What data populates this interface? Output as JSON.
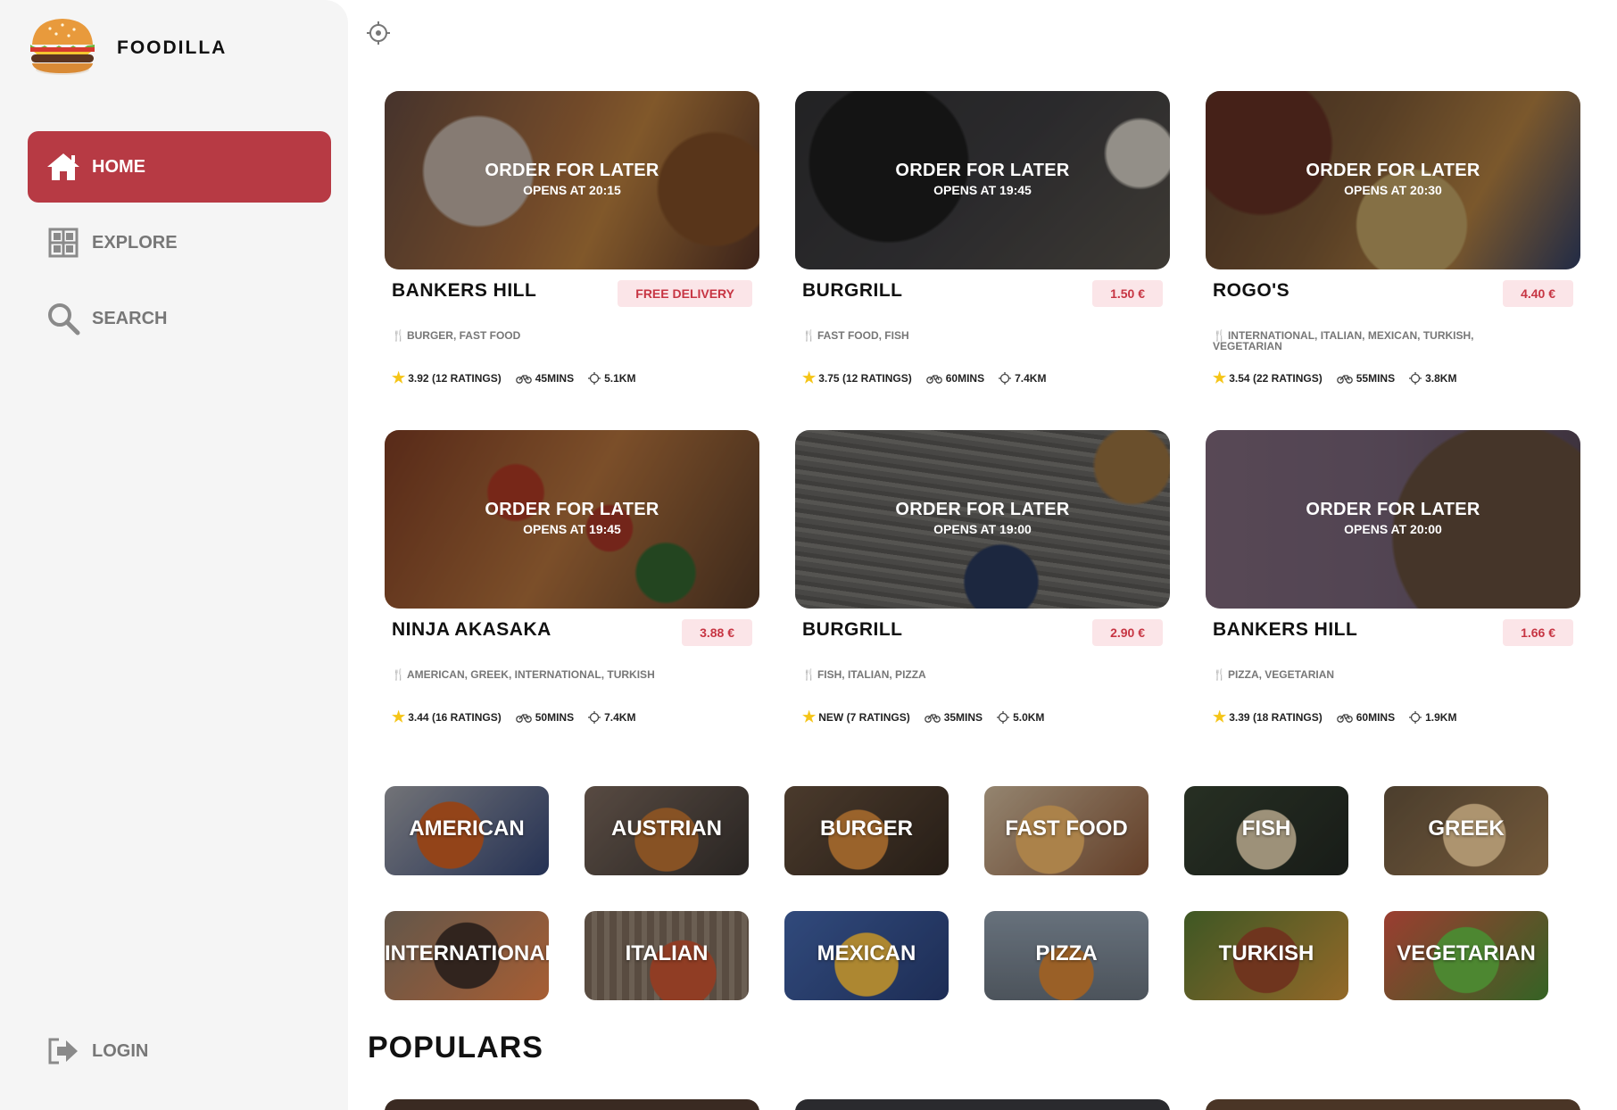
{
  "brand": {
    "name": "FOODILLA"
  },
  "sidebar": {
    "items": [
      {
        "label": "HOME",
        "icon": "home-icon",
        "active": true
      },
      {
        "label": "EXPLORE",
        "icon": "grid-icon",
        "active": false
      },
      {
        "label": "SEARCH",
        "icon": "search-icon",
        "active": false
      }
    ],
    "login": {
      "label": "LOGIN",
      "icon": "login-icon"
    }
  },
  "restaurants": [
    {
      "name": "BANKERS HILL",
      "status": "ORDER FOR LATER",
      "opens": "OPENS AT 20:15",
      "fee": "FREE DELIVERY",
      "cuisine": "BURGER, FAST FOOD",
      "rating": "3.92",
      "ratings": "(12 RATINGS)",
      "time": "45MINS",
      "distance": "5.1KM",
      "photo": "fries-burger"
    },
    {
      "name": "BURGRILL",
      "status": "ORDER FOR LATER",
      "opens": "OPENS AT 19:45",
      "fee": "1.50 €",
      "cuisine": "FAST FOOD, FISH",
      "rating": "3.75",
      "ratings": "(12 RATINGS)",
      "time": "60MINS",
      "distance": "7.4KM",
      "photo": "teapot-sushi"
    },
    {
      "name": "ROGO'S",
      "status": "ORDER FOR LATER",
      "opens": "OPENS AT 20:30",
      "fee": "4.40 €",
      "cuisine": "INTERNATIONAL, ITALIAN, MEXICAN, TURKISH, VEGETARIAN",
      "rating": "3.54",
      "ratings": "(22 RATINGS)",
      "time": "55MINS",
      "distance": "3.8KM",
      "photo": "grill-platter"
    },
    {
      "name": "NINJA AKASAKA",
      "status": "ORDER FOR LATER",
      "opens": "OPENS AT 19:45",
      "fee": "3.88 €",
      "cuisine": "AMERICAN, GREEK, INTERNATIONAL, TURKISH",
      "rating": "3.44",
      "ratings": "(16 RATINGS)",
      "time": "50MINS",
      "distance": "7.4KM",
      "photo": "pizza"
    },
    {
      "name": "BURGRILL",
      "status": "ORDER FOR LATER",
      "opens": "OPENS AT 19:00",
      "fee": "2.90 €",
      "cuisine": "FISH, ITALIAN, PIZZA",
      "rating": "NEW",
      "ratings": "(7 RATINGS)",
      "time": "35MINS",
      "distance": "5.0KM",
      "photo": "wood-blueberries"
    },
    {
      "name": "BANKERS HILL",
      "status": "ORDER FOR LATER",
      "opens": "OPENS AT 20:00",
      "fee": "1.66 €",
      "cuisine": "PIZZA, VEGETARIAN",
      "rating": "3.39",
      "ratings": "(18 RATINGS)",
      "time": "60MINS",
      "distance": "1.9KM",
      "photo": "salad-bowl"
    }
  ],
  "categories": [
    {
      "label": "AMERICAN",
      "photo": "wings"
    },
    {
      "label": "AUSTRIAN",
      "photo": "roast"
    },
    {
      "label": "BURGER",
      "photo": "burger"
    },
    {
      "label": "FAST FOOD",
      "photo": "hotdog"
    },
    {
      "label": "FISH",
      "photo": "fish"
    },
    {
      "label": "GREEK",
      "photo": "gyros"
    },
    {
      "label": "INTERNATIONAL",
      "photo": "steak"
    },
    {
      "label": "ITALIAN",
      "photo": "pasta"
    },
    {
      "label": "MEXICAN",
      "photo": "nachos"
    },
    {
      "label": "PIZZA",
      "photo": "cheeseburger"
    },
    {
      "label": "TURKISH",
      "photo": "kebab"
    },
    {
      "label": "VEGETARIAN",
      "photo": "salad"
    }
  ],
  "populars_title": "POPULARS",
  "colors": {
    "accent": "#b73a44",
    "fee_bg": "#fbe5e8",
    "fee_text": "#c73543",
    "sidebar_bg": "#f5f5f5",
    "star": "#f5c518"
  }
}
